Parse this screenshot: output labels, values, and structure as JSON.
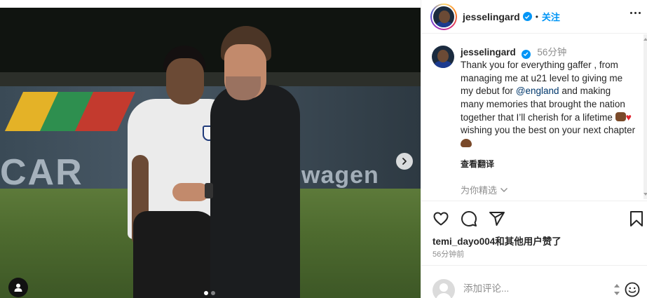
{
  "post": {
    "carousel": {
      "slide_count": 2,
      "active_slide": 1
    }
  },
  "header": {
    "username": "jesselingard",
    "separator": "•",
    "follow_label": "关注"
  },
  "caption": {
    "username": "jesselingard",
    "time": "56分钟",
    "line1": "Thank you for everything gaffer , from managing me at u21 level to giving me my debut for",
    "mention": "@england",
    "line2": "and making many memories that brought the nation together that I’ll cherish for a lifetime",
    "line3": "wishing you the best on your next chapter",
    "translate_label": "查看翻译",
    "selected_label": "为你精选"
  },
  "engagement": {
    "likes_text": "temi_dayo004和其他用户赞了",
    "time_ago": "56分钟前"
  },
  "comment": {
    "placeholder": "添加评论..."
  },
  "icons": {
    "verified": "verified-badge-icon",
    "like": "heart-icon",
    "comment": "comment-icon",
    "share": "paper-plane-icon",
    "save": "bookmark-icon",
    "next": "chevron-right-icon",
    "tag": "user-tag-icon",
    "emoji": "smiley-icon"
  },
  "colors": {
    "accent": "#0095f6",
    "text": "#262626",
    "muted": "#8e8e8e",
    "mention": "#00376b"
  }
}
